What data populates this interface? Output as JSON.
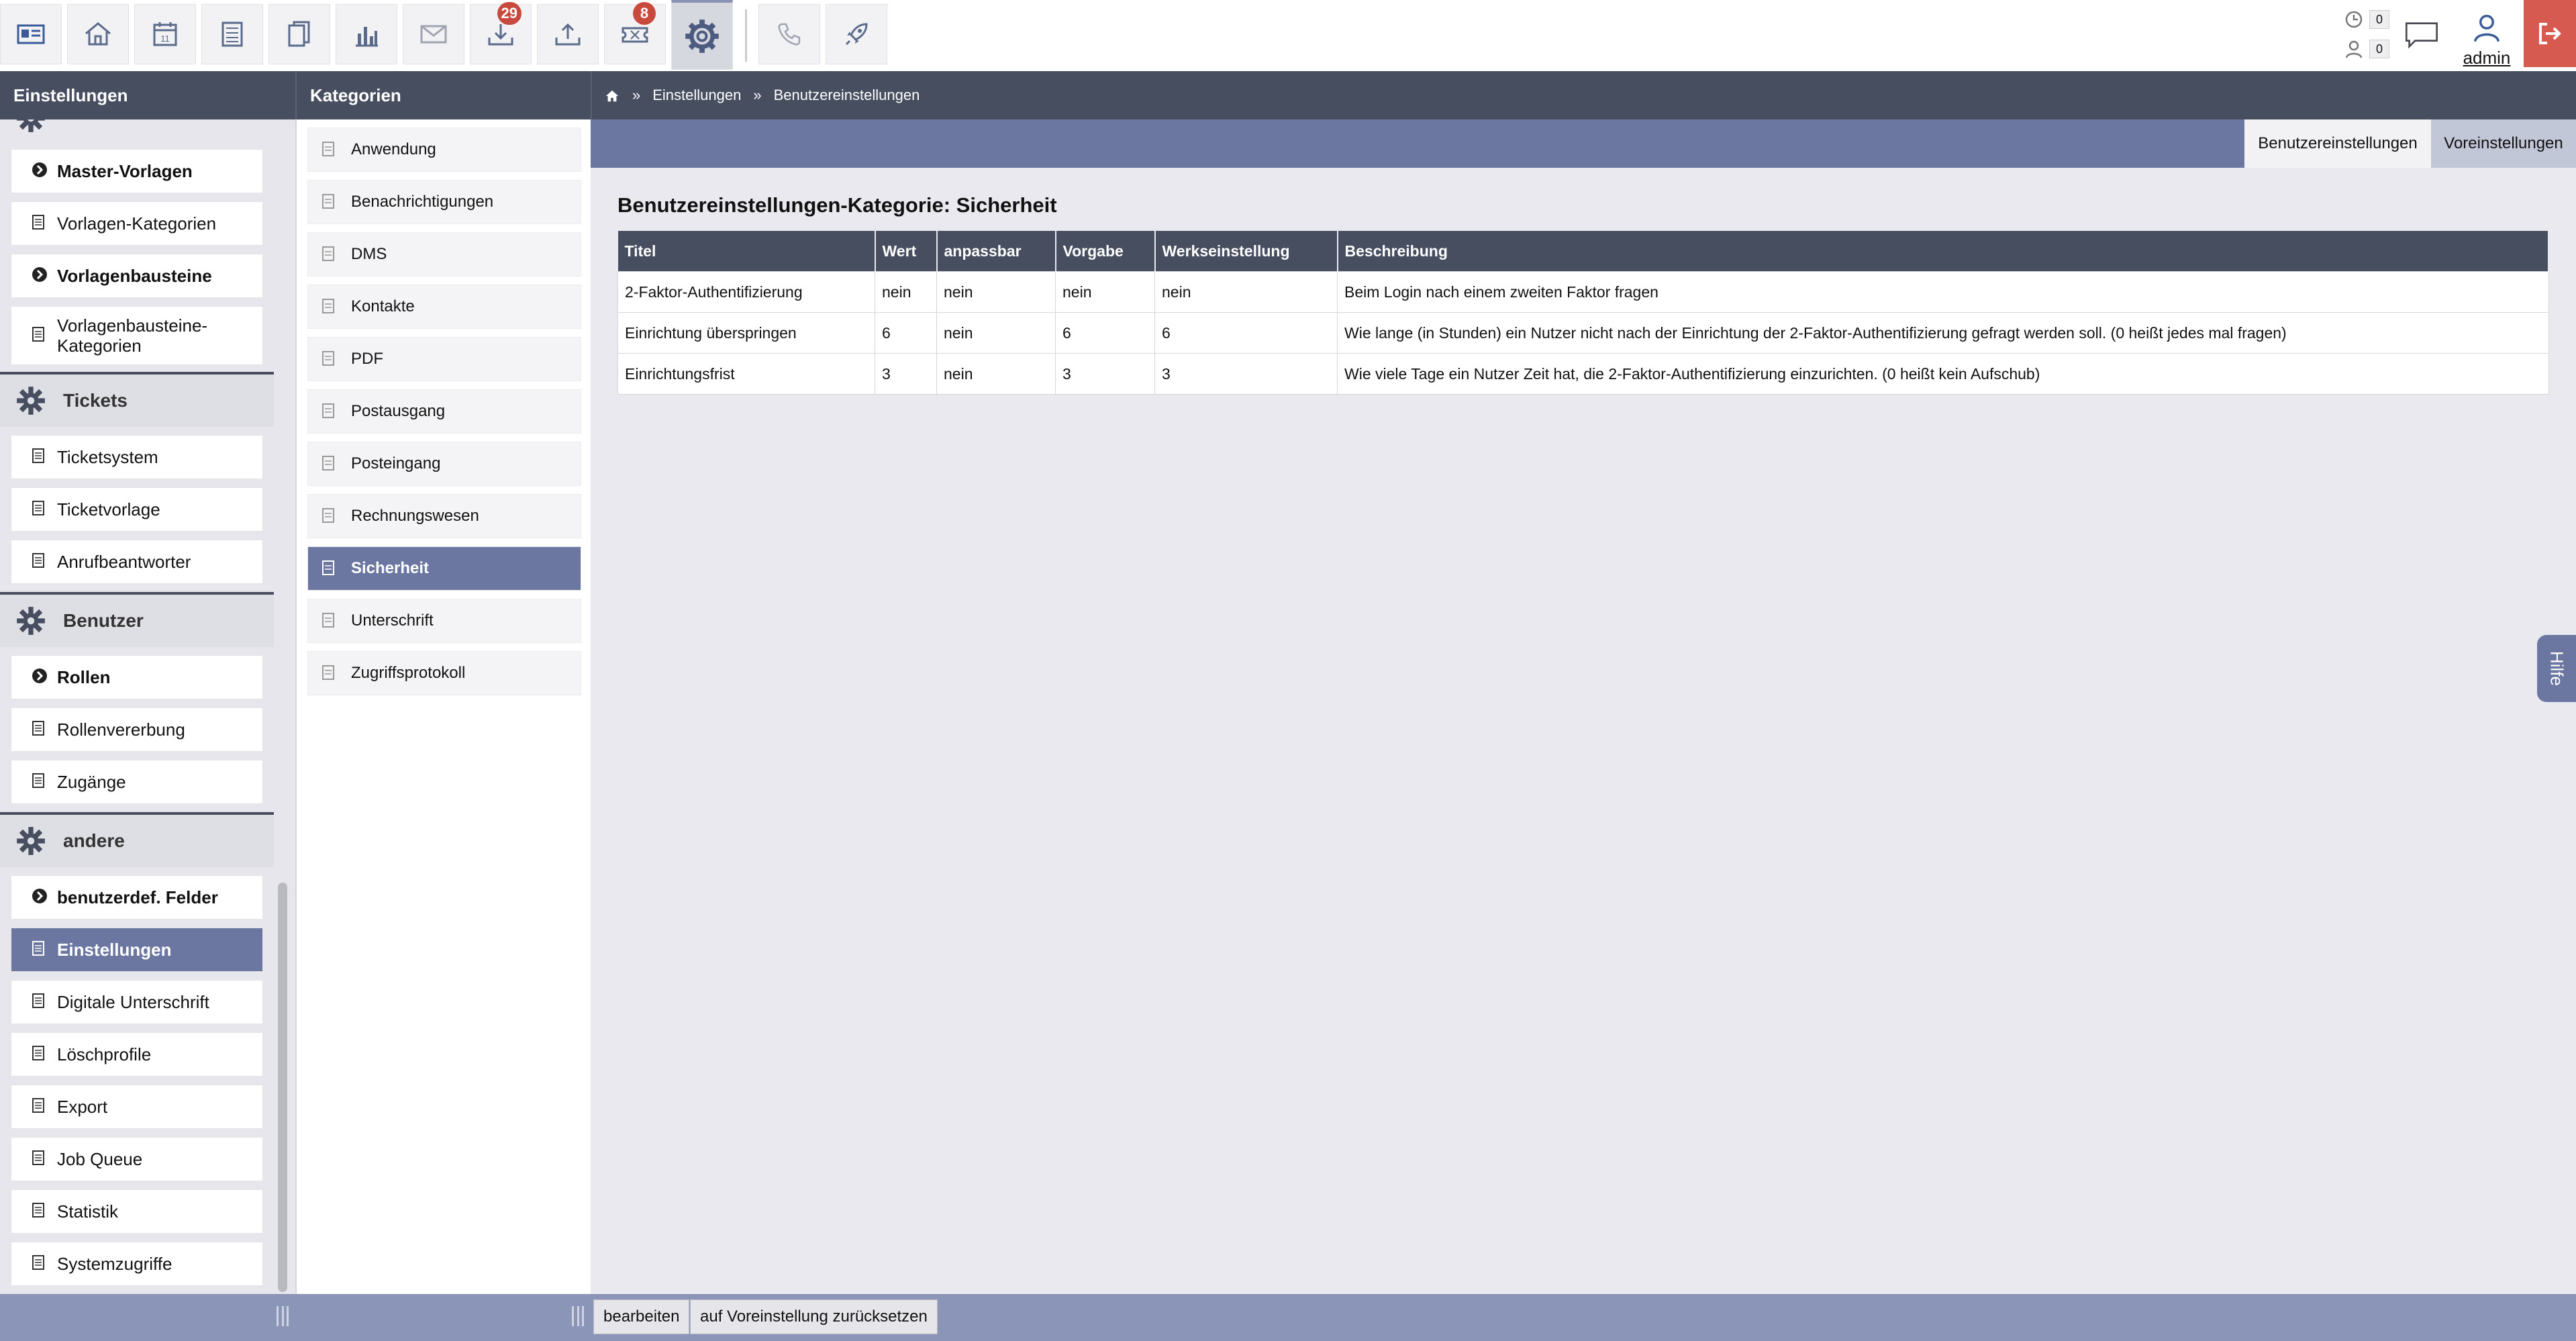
{
  "toolbar": {
    "buttons": [
      {
        "name": "contacts-card-icon"
      },
      {
        "name": "home-icon"
      },
      {
        "name": "calendar-icon",
        "day": "11"
      },
      {
        "name": "ledger-icon"
      },
      {
        "name": "documents-icon"
      },
      {
        "name": "bar-chart-icon"
      },
      {
        "name": "mail-icon"
      },
      {
        "name": "inbox-download-icon",
        "badge": "29"
      },
      {
        "name": "outbox-upload-icon"
      },
      {
        "name": "ticket-icon",
        "badge": "8"
      },
      {
        "name": "gear-icon"
      },
      {
        "name": "phone-icon"
      },
      {
        "name": "rocket-icon"
      }
    ],
    "counter_top": "0",
    "counter_bottom": "0",
    "user_label": "admin"
  },
  "sidebar": {
    "header": "Einstellungen",
    "items": [
      {
        "label": "Master-Vorlagen",
        "type": "bold"
      },
      {
        "label": "Vorlagen-Kategorien",
        "type": "doc"
      },
      {
        "label": "Vorlagenbausteine",
        "type": "bold"
      },
      {
        "label": "Vorlagenbausteine-Kategorien",
        "type": "doc"
      },
      {
        "label": "Tickets",
        "type": "group"
      },
      {
        "label": "Ticketsystem",
        "type": "doc"
      },
      {
        "label": "Ticketvorlage",
        "type": "doc"
      },
      {
        "label": "Anrufbeantworter",
        "type": "doc"
      },
      {
        "label": "Benutzer",
        "type": "group"
      },
      {
        "label": "Rollen",
        "type": "bold"
      },
      {
        "label": "Rollenvererbung",
        "type": "doc"
      },
      {
        "label": "Zugänge",
        "type": "doc"
      },
      {
        "label": "andere",
        "type": "group"
      },
      {
        "label": "benutzerdef. Felder",
        "type": "bold"
      },
      {
        "label": "Einstellungen",
        "type": "active"
      },
      {
        "label": "Digitale Unterschrift",
        "type": "doc"
      },
      {
        "label": "Löschprofile",
        "type": "doc"
      },
      {
        "label": "Export",
        "type": "doc"
      },
      {
        "label": "Job Queue",
        "type": "doc"
      },
      {
        "label": "Statistik",
        "type": "doc"
      },
      {
        "label": "Systemzugriffe",
        "type": "doc"
      }
    ]
  },
  "categories": {
    "header": "Kategorien",
    "items": [
      "Anwendung",
      "Benachrichtigungen",
      "DMS",
      "Kontakte",
      "PDF",
      "Postausgang",
      "Posteingang",
      "Rechnungswesen",
      "Sicherheit",
      "Unterschrift",
      "Zugriffsprotokoll"
    ],
    "active": "Sicherheit"
  },
  "breadcrumb": {
    "sep": "»",
    "items": [
      "Einstellungen",
      "Benutzereinstellungen"
    ]
  },
  "tabs": [
    "Benutzereinstellungen",
    "Voreinstellungen"
  ],
  "main": {
    "title": "Benutzereinstellungen-Kategorie: Sicherheit",
    "columns": [
      "Titel",
      "Wert",
      "anpassbar",
      "Vorgabe",
      "Werkseinstellung",
      "Beschreibung"
    ],
    "rows": [
      [
        "2-Faktor-Authentifizierung",
        "nein",
        "nein",
        "nein",
        "nein",
        "Beim Login nach einem zweiten Faktor fragen"
      ],
      [
        "Einrichtung überspringen",
        "6",
        "nein",
        "6",
        "6",
        "Wie lange (in Stunden) ein Nutzer nicht nach der Einrichtung der 2-Faktor-Authentifizierung gefragt werden soll. (0 heißt jedes mal fragen)"
      ],
      [
        "Einrichtungsfrist",
        "3",
        "nein",
        "3",
        "3",
        "Wie viele Tage ein Nutzer Zeit hat, die 2-Faktor-Authentifizierung einzurichten. (0 heißt kein Aufschub)"
      ]
    ]
  },
  "help_label": "Hilfe",
  "bottom": {
    "edit_label": "bearbeiten",
    "reset_label": "auf Voreinstellung zurücksetzen"
  },
  "colors": {
    "accent": "#6b77a0",
    "header": "#474e5f",
    "badge": "#c84a3f",
    "logout": "#d65a50"
  }
}
